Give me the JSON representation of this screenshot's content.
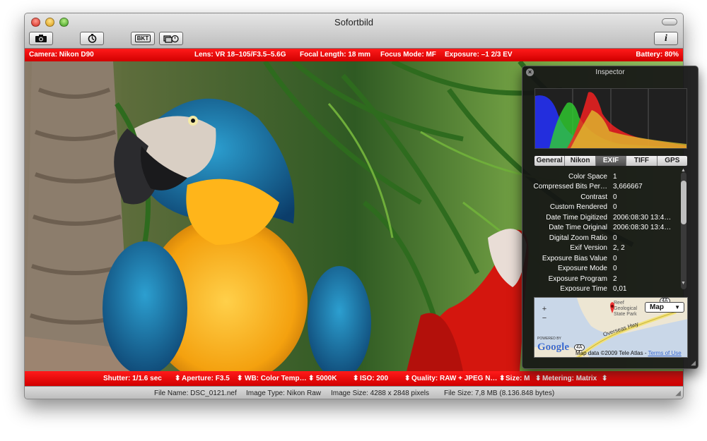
{
  "window": {
    "title": "Sofortbild"
  },
  "toolbar": {
    "bkt_label": "BKT",
    "info_label": "i"
  },
  "top_bar": {
    "camera": "Camera: Nikon D90",
    "lens": "Lens: VR 18–105/F3.5–5.6G",
    "focal": "Focal Length: 18 mm",
    "focus": "Focus Mode: MF",
    "exposure": "Exposure: –1 2/3 EV",
    "battery": "Battery: 80%"
  },
  "bottom_bar": {
    "shutter": "Shutter: 1/1.6 sec",
    "aperture": "Aperture: F3.5",
    "wb": "WB: Color Temp…",
    "kelvin": "5000K",
    "iso": "ISO: 200",
    "quality": "Quality: RAW + JPEG N…",
    "size": "Size: M",
    "metering": "Metering: Matrix"
  },
  "status": {
    "file_name": "File Name: DSC_0121.nef",
    "image_type": "Image Type: Nikon Raw",
    "image_size": "Image Size: 4288 x 2848 pixels",
    "file_size": "File Size: 7,8 MB (8.136.848 bytes)"
  },
  "inspector": {
    "title": "Inspector",
    "tabs": [
      {
        "label": "General"
      },
      {
        "label": "Nikon"
      },
      {
        "label": "EXIF",
        "selected": true
      },
      {
        "label": "TIFF"
      },
      {
        "label": "GPS"
      }
    ],
    "rows": [
      {
        "key": "Color Space",
        "value": "1"
      },
      {
        "key": "Compressed Bits Per…",
        "value": "3,666667"
      },
      {
        "key": "Contrast",
        "value": "0"
      },
      {
        "key": "Custom Rendered",
        "value": "0"
      },
      {
        "key": "Date Time Digitized",
        "value": "2006:08:30 13:4…"
      },
      {
        "key": "Date Time Original",
        "value": "2006:08:30 13:4…"
      },
      {
        "key": "Digital Zoom Ratio",
        "value": "0"
      },
      {
        "key": "Exif Version",
        "value": "2, 2"
      },
      {
        "key": "Exposure Bias Value",
        "value": "0"
      },
      {
        "key": "Exposure Mode",
        "value": "0"
      },
      {
        "key": "Exposure Program",
        "value": "2"
      },
      {
        "key": "Exposure Time",
        "value": "0,01"
      }
    ],
    "map": {
      "type_selector": "Map",
      "park_label": "Reef Geological State Park",
      "road_label": "Overseas Hwy",
      "route_badge_1": "4A",
      "route_badge_2": "4A",
      "google_powered": "POWERED BY",
      "google_logo": "Google",
      "copyright": "Map data ©2009 Tele Atlas - ",
      "terms": "Terms of Use"
    }
  }
}
